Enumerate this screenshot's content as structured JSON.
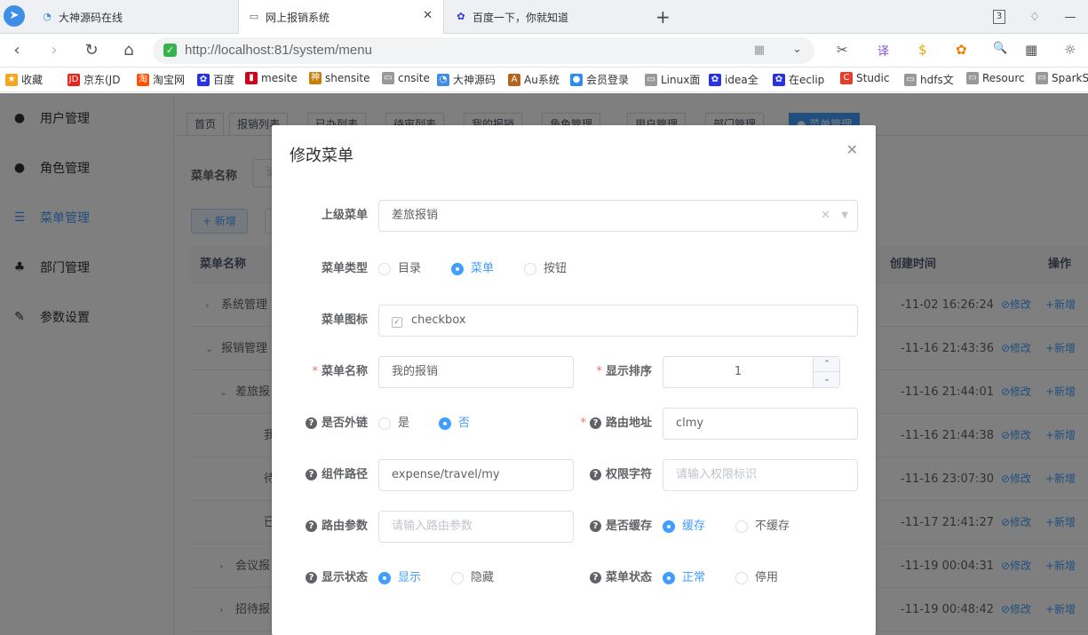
{
  "browser": {
    "logo_glyph": "➤",
    "tabs": [
      {
        "title": "大神源码在线",
        "icon_glyph": "◔"
      },
      {
        "title": "网上报销系统",
        "icon_glyph": "▭",
        "close_glyph": "✕"
      },
      {
        "title": "百度一下，你就知道",
        "icon_glyph": "✿"
      }
    ],
    "new_tab_glyph": "+",
    "window_buttons": [
      "3",
      "♢",
      "—"
    ],
    "url": "http://localhost:81/system/menu",
    "nav": {
      "back": "‹",
      "forward": "›",
      "reload": "↻",
      "home": "⌂"
    },
    "url_glyphs": {
      "secure": "✓",
      "qr": "▦",
      "dropdown": "⌄"
    },
    "toolbar_glyphs": [
      "✂",
      "译",
      "$",
      "✿",
      "🔍",
      "▦",
      "☼"
    ]
  },
  "bookmarks": [
    {
      "label": "收藏",
      "icon_glyph": "★",
      "color": "#f5a623"
    },
    {
      "label": "京东(JD",
      "icon_glyph": "JD",
      "color": "#e1251b"
    },
    {
      "label": "淘宝网",
      "icon_glyph": "淘",
      "color": "#ff5000"
    },
    {
      "label": "百度",
      "icon_glyph": "✿",
      "color": "#2932e1"
    },
    {
      "label": "mesite",
      "icon_glyph": "▮",
      "color": "#d0021b"
    },
    {
      "label": "shensite",
      "icon_glyph": "神",
      "color": "#c87f0a"
    },
    {
      "label": "cnsite",
      "icon_glyph": "▭",
      "color": "#999999"
    },
    {
      "label": "大神源码",
      "icon_glyph": "◔",
      "color": "#3f8ee5"
    },
    {
      "label": "Au系统",
      "icon_glyph": "A",
      "color": "#b5651d"
    },
    {
      "label": "会员登录",
      "icon_glyph": "●",
      "color": "#2d8cf0"
    },
    {
      "label": "Linux面",
      "icon_glyph": "▭",
      "color": "#999999"
    },
    {
      "label": "idea全",
      "icon_glyph": "✿",
      "color": "#2932e1"
    },
    {
      "label": "在eclip",
      "icon_glyph": "✿",
      "color": "#2932e1"
    },
    {
      "label": "Studic",
      "icon_glyph": "C",
      "color": "#e43e2b"
    },
    {
      "label": "hdfs文",
      "icon_glyph": "▭",
      "color": "#999999"
    },
    {
      "label": "Resourc",
      "icon_glyph": "▭",
      "color": "#999999"
    },
    {
      "label": "SparkS",
      "icon_glyph": "▭",
      "color": "#999999"
    }
  ],
  "sidebar": {
    "items": [
      {
        "label": "用户管理",
        "icon_glyph": "●"
      },
      {
        "label": "角色管理",
        "icon_glyph": "●"
      },
      {
        "label": "菜单管理",
        "icon_glyph": "☰"
      },
      {
        "label": "部门管理",
        "icon_glyph": "♣"
      },
      {
        "label": "参数设置",
        "icon_glyph": "✎"
      }
    ]
  },
  "tags": [
    "首页",
    "报销列表",
    "已办列表",
    "待审列表",
    "我的报销",
    "角色管理",
    "用户管理",
    "部门管理",
    "● 菜单管理"
  ],
  "search": {
    "label": "菜单名称",
    "placeholder": "请"
  },
  "buttons": {
    "add": "+ 新增"
  },
  "table": {
    "headers": {
      "name": "菜单名称",
      "created": "创建时间",
      "actions": "操作"
    },
    "caret_right": "›",
    "caret_down": "⌄",
    "rows": [
      {
        "name": "系统管理",
        "caret": "›",
        "time": "-11-02 16:26:24"
      },
      {
        "name": "报销管理",
        "caret": "⌄",
        "time": "-11-16 21:43:36"
      },
      {
        "name": "差旅报",
        "caret": "⌄",
        "time": "-11-16 21:44:01"
      },
      {
        "name": "我的",
        "caret": "",
        "time": "-11-16 21:44:38"
      },
      {
        "name": "待审",
        "caret": "",
        "time": "-11-16 23:07:30"
      },
      {
        "name": "已办",
        "caret": "",
        "time": "-11-17 21:41:27"
      },
      {
        "name": "会议报",
        "caret": "›",
        "time": "-11-19 00:04:31"
      },
      {
        "name": "招待报",
        "caret": "›",
        "time": "-11-19 00:48:42"
      }
    ],
    "edit_label": "⊘修改",
    "add_label": "+新增"
  },
  "dialog": {
    "title": "修改菜单",
    "close_glyph": "✕",
    "fields": {
      "parent": {
        "label": "上级菜单",
        "value": "差旅报销",
        "clear_glyph": "✕",
        "caret_glyph": "▼"
      },
      "type": {
        "label": "菜单类型",
        "options": [
          "目录",
          "菜单",
          "按钮"
        ],
        "selected": "菜单"
      },
      "icon": {
        "label": "菜单图标",
        "value": "checkbox",
        "icon_glyph": "✓"
      },
      "name": {
        "label": "菜单名称",
        "value": "我的报销"
      },
      "order": {
        "label": "显示排序",
        "value": "1",
        "up_glyph": "⌃",
        "down_glyph": "⌄"
      },
      "external": {
        "label": "是否外链",
        "options": [
          "是",
          "否"
        ],
        "selected": "否"
      },
      "route": {
        "label": "路由地址",
        "value": "clmy"
      },
      "component": {
        "label": "组件路径",
        "value": "expense/travel/my"
      },
      "perms": {
        "label": "权限字符",
        "placeholder": "请输入权限标识"
      },
      "query": {
        "label": "路由参数",
        "placeholder": "请输入路由参数"
      },
      "cache": {
        "label": "是否缓存",
        "options": [
          "缓存",
          "不缓存"
        ],
        "selected": "缓存"
      },
      "visible": {
        "label": "显示状态",
        "options": [
          "显示",
          "隐藏"
        ],
        "selected": "显示"
      },
      "status": {
        "label": "菜单状态",
        "options": [
          "正常",
          "停用"
        ],
        "selected": "正常"
      }
    },
    "help_glyph": "?",
    "required_glyph": "*"
  },
  "colors": {
    "primary": "#409eff",
    "required": "#f56c6c",
    "overlay": "rgba(0,0,0,0.5)"
  }
}
